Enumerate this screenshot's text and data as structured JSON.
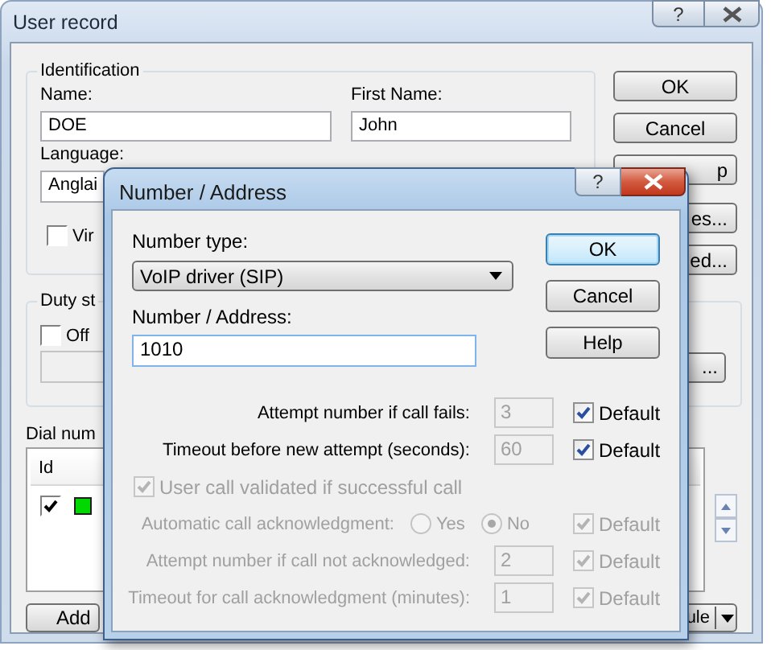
{
  "window": {
    "title": "User record",
    "title_buttons": [
      "?"
    ]
  },
  "identification": {
    "title": "Identification",
    "name_label": "Name:",
    "name_value": "DOE",
    "first_name_label": "First Name:",
    "first_name_value": "John",
    "language_label": "Language:",
    "language_value": "Anglai",
    "option": {
      "label": "Vir",
      "checked": false
    }
  },
  "side_buttons": [
    {
      "label": "OK",
      "clipped": false
    },
    {
      "label": "Cancel",
      "clipped": false
    },
    {
      "label": "p",
      "clipped": true
    },
    {
      "label": "es...",
      "clipped": true
    },
    {
      "label": "ed...",
      "clipped": true
    }
  ],
  "duty": {
    "title": "Duty st",
    "option": {
      "label": "Off",
      "checked": false
    },
    "button": "..."
  },
  "dial_numbers": {
    "label": "Dial num",
    "columns": [
      "Id"
    ],
    "rows": [
      {
        "checked": true,
        "color": "#00d800"
      }
    ]
  },
  "add_button": "Add",
  "split_button": "ule",
  "dialog": {
    "title": "Number / Address",
    "title_buttons": [
      "?"
    ],
    "number_type_label": "Number type:",
    "number_type_value": "VoIP driver (SIP)",
    "address_label": "Number / Address:",
    "address_value": "1010",
    "buttons": [
      {
        "label": "OK",
        "default": true
      },
      {
        "label": "Cancel",
        "default": false
      },
      {
        "label": "Help",
        "default": false
      }
    ],
    "settings": [
      {
        "kind": "field",
        "label": "Attempt number if call fails:",
        "value": "3",
        "disabled": false,
        "default": {
          "label": "Default",
          "checked": true,
          "disabled": false
        }
      },
      {
        "kind": "field",
        "label": "Timeout before new attempt (seconds):",
        "value": "60",
        "disabled": false,
        "default": {
          "label": "Default",
          "checked": true,
          "disabled": false
        }
      },
      {
        "kind": "checkbox",
        "label": "User call validated if successful call",
        "checked": true,
        "disabled": true
      },
      {
        "kind": "radio",
        "label": "Automatic call acknowledgment:",
        "disabled": true,
        "options": [
          {
            "label": "Yes",
            "selected": false
          },
          {
            "label": "No",
            "selected": true
          }
        ],
        "default": {
          "label": "Default",
          "checked": true,
          "disabled": true
        }
      },
      {
        "kind": "field",
        "label": "Attempt number if call not acknowledged:",
        "value": "2",
        "disabled": true,
        "default": {
          "label": "Default",
          "checked": true,
          "disabled": true
        }
      },
      {
        "kind": "field",
        "label": "Timeout for call acknowledgment (minutes):",
        "value": "1",
        "disabled": true,
        "default": {
          "label": "Default",
          "checked": true,
          "disabled": true
        }
      }
    ]
  }
}
